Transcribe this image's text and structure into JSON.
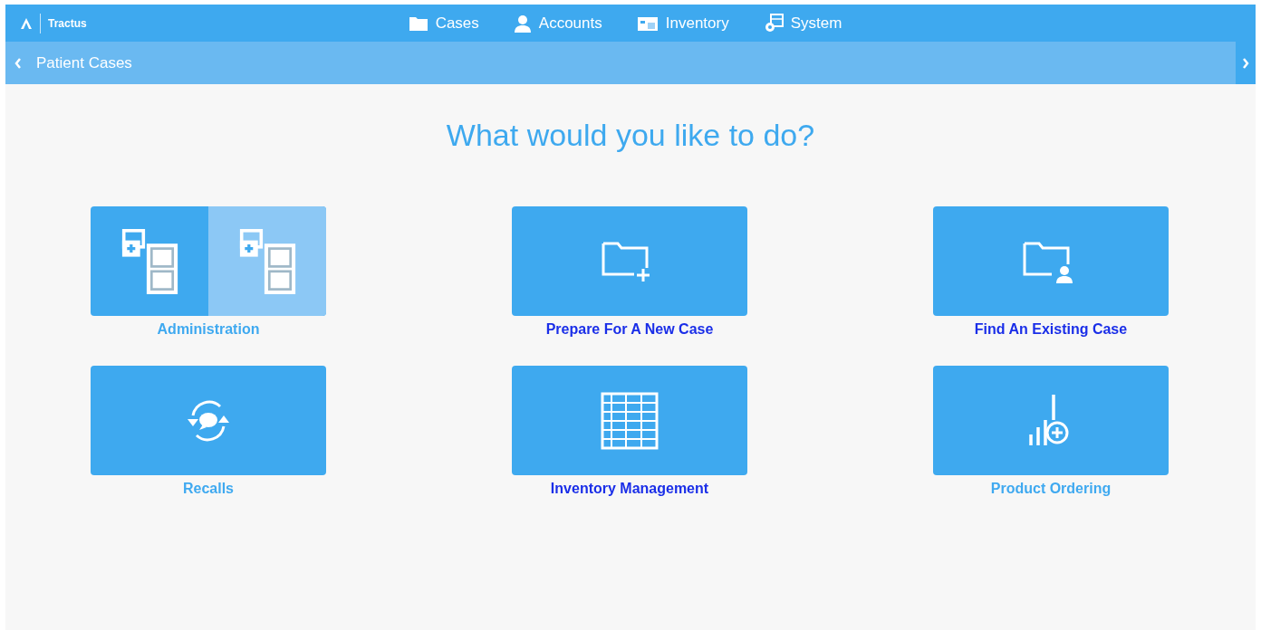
{
  "topbar": {
    "brand": "Tractus",
    "nav": [
      {
        "kind": "folder",
        "label": "Cases"
      },
      {
        "kind": "person",
        "label": "Accounts"
      },
      {
        "kind": "inventory",
        "label": "Inventory"
      },
      {
        "kind": "system",
        "label": "System"
      }
    ]
  },
  "breadcrumb": {
    "title": "Patient Cases"
  },
  "heading": "What would you like to do?",
  "tiles": [
    {
      "kind": "admin",
      "label": "Administration",
      "color": "#3fa9f0",
      "pressed": true
    },
    {
      "kind": "new-case",
      "label": "Prepare For A New Case",
      "color": "#1a2ee8",
      "pressed": false
    },
    {
      "kind": "find-case",
      "label": "Find An Existing Case",
      "color": "#1a2ee8",
      "pressed": false
    },
    {
      "kind": "recalls",
      "label": "Recalls",
      "color": "#3fa9f0",
      "pressed": false
    },
    {
      "kind": "inventory",
      "label": "Inventory Management",
      "color": "#1a2ee8",
      "pressed": false
    },
    {
      "kind": "ordering",
      "label": "Product Ordering",
      "color": "#3fa9f0",
      "pressed": false
    }
  ]
}
